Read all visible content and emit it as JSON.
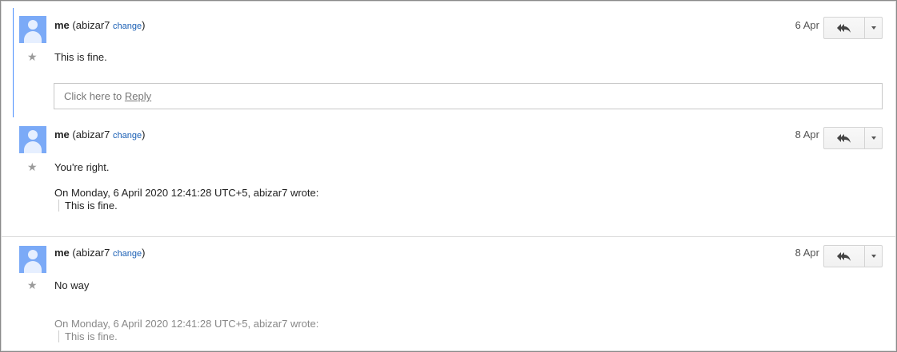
{
  "messages": [
    {
      "sender_name": "me",
      "sender_account": "abizar7",
      "change_label": "change",
      "date": "6 Apr",
      "body": "This is fine.",
      "reply_box": {
        "prefix": "Click here to ",
        "link": "Reply"
      }
    },
    {
      "sender_name": "me",
      "sender_account": "abizar7",
      "change_label": "change",
      "date": "8 Apr",
      "body": "You're right.",
      "quote_header": "On Monday, 6 April 2020 12:41:28 UTC+5, abizar7 wrote:",
      "quote_text": "This is fine."
    },
    {
      "sender_name": "me",
      "sender_account": "abizar7",
      "change_label": "change",
      "date": "8 Apr",
      "body": "No way",
      "quote_header": "On Monday, 6 April 2020 12:41:28 UTC+5, abizar7 wrote:",
      "quote_text": "This is fine."
    }
  ],
  "icons": {
    "reply_all": "reply-all-icon",
    "more": "chevron-down-icon",
    "star": "star-icon",
    "avatar": "avatar-icon"
  },
  "colors": {
    "accent": "#4d90fe",
    "link": "#1a5fb4",
    "avatar": "#7baaf7"
  }
}
